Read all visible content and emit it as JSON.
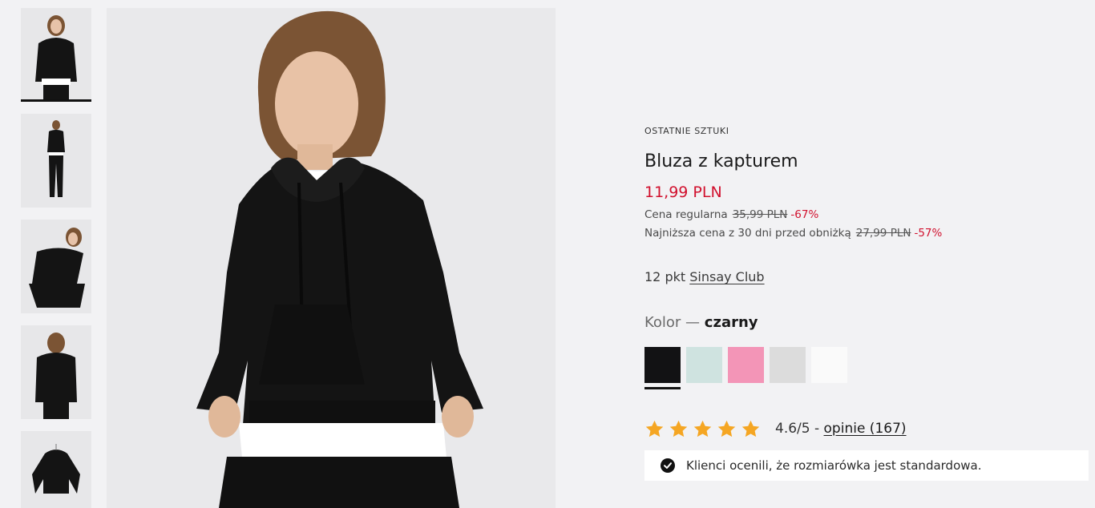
{
  "product": {
    "badge": "OSTATNIE SZTUKI",
    "title": "Bluza z kapturem",
    "price": "11,99 PLN",
    "regular_label": "Cena regularna",
    "regular_price": "35,99 PLN",
    "regular_discount": "-67%",
    "lowest_label": "Najniższa cena z 30 dni przed obniżką",
    "lowest_price": "27,99 PLN",
    "lowest_discount": "-57%"
  },
  "club": {
    "points": "12 pkt",
    "link": "Sinsay Club"
  },
  "color": {
    "label": "Kolor —",
    "selected": "czarny",
    "swatches": [
      {
        "name": "czarny",
        "hex": "#121214"
      },
      {
        "name": "miętowy",
        "hex": "#cfe3e0"
      },
      {
        "name": "różowy",
        "hex": "#f395b7"
      },
      {
        "name": "szary",
        "hex": "#dcdcdc"
      },
      {
        "name": "biały",
        "hex": "#fafafa"
      }
    ]
  },
  "rating": {
    "stars": 5,
    "star_color": "#f5a623",
    "score": "4.6/5 -",
    "reviews_link": "opinie (167)"
  },
  "fit_note": "Klienci ocenili, że rozmiarówka jest standardowa.",
  "gallery": {
    "thumbnails": [
      "thumbnail-front",
      "thumbnail-full-length",
      "thumbnail-sitting",
      "thumbnail-back",
      "thumbnail-flat"
    ],
    "active_index": 0
  }
}
